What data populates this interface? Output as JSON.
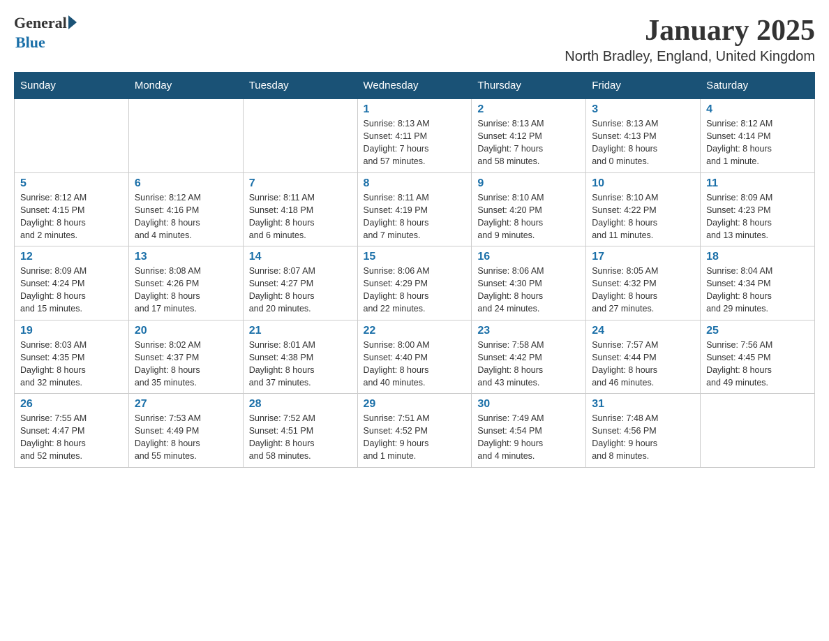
{
  "logo": {
    "general": "General",
    "blue": "Blue"
  },
  "title": "January 2025",
  "location": "North Bradley, England, United Kingdom",
  "days_of_week": [
    "Sunday",
    "Monday",
    "Tuesday",
    "Wednesday",
    "Thursday",
    "Friday",
    "Saturday"
  ],
  "weeks": [
    [
      {
        "day": "",
        "info": ""
      },
      {
        "day": "",
        "info": ""
      },
      {
        "day": "",
        "info": ""
      },
      {
        "day": "1",
        "info": "Sunrise: 8:13 AM\nSunset: 4:11 PM\nDaylight: 7 hours\nand 57 minutes."
      },
      {
        "day": "2",
        "info": "Sunrise: 8:13 AM\nSunset: 4:12 PM\nDaylight: 7 hours\nand 58 minutes."
      },
      {
        "day": "3",
        "info": "Sunrise: 8:13 AM\nSunset: 4:13 PM\nDaylight: 8 hours\nand 0 minutes."
      },
      {
        "day": "4",
        "info": "Sunrise: 8:12 AM\nSunset: 4:14 PM\nDaylight: 8 hours\nand 1 minute."
      }
    ],
    [
      {
        "day": "5",
        "info": "Sunrise: 8:12 AM\nSunset: 4:15 PM\nDaylight: 8 hours\nand 2 minutes."
      },
      {
        "day": "6",
        "info": "Sunrise: 8:12 AM\nSunset: 4:16 PM\nDaylight: 8 hours\nand 4 minutes."
      },
      {
        "day": "7",
        "info": "Sunrise: 8:11 AM\nSunset: 4:18 PM\nDaylight: 8 hours\nand 6 minutes."
      },
      {
        "day": "8",
        "info": "Sunrise: 8:11 AM\nSunset: 4:19 PM\nDaylight: 8 hours\nand 7 minutes."
      },
      {
        "day": "9",
        "info": "Sunrise: 8:10 AM\nSunset: 4:20 PM\nDaylight: 8 hours\nand 9 minutes."
      },
      {
        "day": "10",
        "info": "Sunrise: 8:10 AM\nSunset: 4:22 PM\nDaylight: 8 hours\nand 11 minutes."
      },
      {
        "day": "11",
        "info": "Sunrise: 8:09 AM\nSunset: 4:23 PM\nDaylight: 8 hours\nand 13 minutes."
      }
    ],
    [
      {
        "day": "12",
        "info": "Sunrise: 8:09 AM\nSunset: 4:24 PM\nDaylight: 8 hours\nand 15 minutes."
      },
      {
        "day": "13",
        "info": "Sunrise: 8:08 AM\nSunset: 4:26 PM\nDaylight: 8 hours\nand 17 minutes."
      },
      {
        "day": "14",
        "info": "Sunrise: 8:07 AM\nSunset: 4:27 PM\nDaylight: 8 hours\nand 20 minutes."
      },
      {
        "day": "15",
        "info": "Sunrise: 8:06 AM\nSunset: 4:29 PM\nDaylight: 8 hours\nand 22 minutes."
      },
      {
        "day": "16",
        "info": "Sunrise: 8:06 AM\nSunset: 4:30 PM\nDaylight: 8 hours\nand 24 minutes."
      },
      {
        "day": "17",
        "info": "Sunrise: 8:05 AM\nSunset: 4:32 PM\nDaylight: 8 hours\nand 27 minutes."
      },
      {
        "day": "18",
        "info": "Sunrise: 8:04 AM\nSunset: 4:34 PM\nDaylight: 8 hours\nand 29 minutes."
      }
    ],
    [
      {
        "day": "19",
        "info": "Sunrise: 8:03 AM\nSunset: 4:35 PM\nDaylight: 8 hours\nand 32 minutes."
      },
      {
        "day": "20",
        "info": "Sunrise: 8:02 AM\nSunset: 4:37 PM\nDaylight: 8 hours\nand 35 minutes."
      },
      {
        "day": "21",
        "info": "Sunrise: 8:01 AM\nSunset: 4:38 PM\nDaylight: 8 hours\nand 37 minutes."
      },
      {
        "day": "22",
        "info": "Sunrise: 8:00 AM\nSunset: 4:40 PM\nDaylight: 8 hours\nand 40 minutes."
      },
      {
        "day": "23",
        "info": "Sunrise: 7:58 AM\nSunset: 4:42 PM\nDaylight: 8 hours\nand 43 minutes."
      },
      {
        "day": "24",
        "info": "Sunrise: 7:57 AM\nSunset: 4:44 PM\nDaylight: 8 hours\nand 46 minutes."
      },
      {
        "day": "25",
        "info": "Sunrise: 7:56 AM\nSunset: 4:45 PM\nDaylight: 8 hours\nand 49 minutes."
      }
    ],
    [
      {
        "day": "26",
        "info": "Sunrise: 7:55 AM\nSunset: 4:47 PM\nDaylight: 8 hours\nand 52 minutes."
      },
      {
        "day": "27",
        "info": "Sunrise: 7:53 AM\nSunset: 4:49 PM\nDaylight: 8 hours\nand 55 minutes."
      },
      {
        "day": "28",
        "info": "Sunrise: 7:52 AM\nSunset: 4:51 PM\nDaylight: 8 hours\nand 58 minutes."
      },
      {
        "day": "29",
        "info": "Sunrise: 7:51 AM\nSunset: 4:52 PM\nDaylight: 9 hours\nand 1 minute."
      },
      {
        "day": "30",
        "info": "Sunrise: 7:49 AM\nSunset: 4:54 PM\nDaylight: 9 hours\nand 4 minutes."
      },
      {
        "day": "31",
        "info": "Sunrise: 7:48 AM\nSunset: 4:56 PM\nDaylight: 9 hours\nand 8 minutes."
      },
      {
        "day": "",
        "info": ""
      }
    ]
  ]
}
